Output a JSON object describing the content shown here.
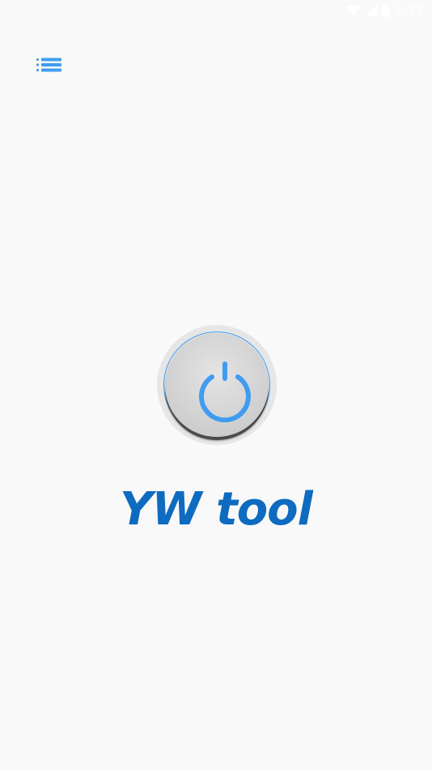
{
  "status_bar": {
    "time": "5:21",
    "icons": [
      "wifi-icon",
      "cellular-signal-icon",
      "battery-icon"
    ],
    "icon_color": "#ffffff"
  },
  "toolbar": {
    "menu_icon": "list-menu-icon",
    "accent_color": "#3f9cf0"
  },
  "main": {
    "power_icon": "power-icon",
    "power_color": "#3f9cf0",
    "title": "YW tool",
    "title_color": "#0e6bc0"
  }
}
